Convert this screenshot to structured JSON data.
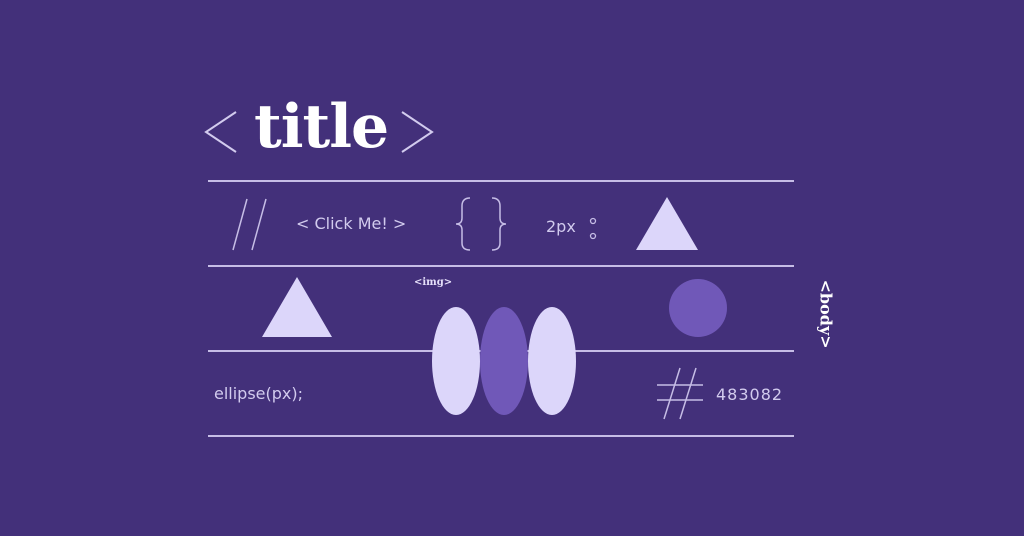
{
  "colors": {
    "background": "#43307a",
    "line": "#c6bde6",
    "light_shape": "#dcd6fa",
    "accent_shape": "#7058b8",
    "text_light": "#d2cbee",
    "title": "#ffffff"
  },
  "header": {
    "open_bracket": "<",
    "title": "title",
    "close_bracket": ">"
  },
  "row1": {
    "comment_glyph": "//",
    "button_label": "< Click Me! >",
    "braces": "{ }",
    "size_text": "2px",
    "colon": ":"
  },
  "row2": {
    "img_tag": "<img>",
    "body_tag": "<body>"
  },
  "row3": {
    "function_text": "ellipse(px);",
    "hash_glyph": "#",
    "hex_value": "483082"
  }
}
